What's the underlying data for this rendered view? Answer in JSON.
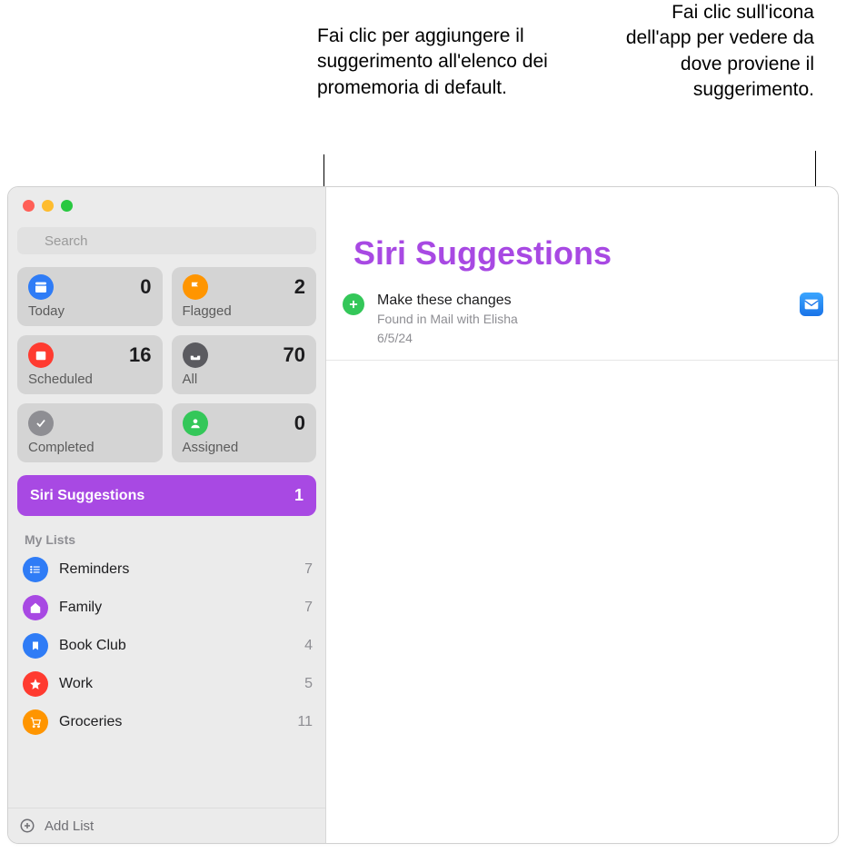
{
  "callouts": {
    "left": "Fai clic per aggiungere il suggerimento all'elenco dei promemoria di default.",
    "right": "Fai clic sull'icona dell'app per vedere da dove proviene il suggerimento."
  },
  "sidebar": {
    "search_placeholder": "Search",
    "smart": {
      "today": {
        "label": "Today",
        "count": "0",
        "color": "#2f7cf6"
      },
      "flagged": {
        "label": "Flagged",
        "count": "2",
        "color": "#ff9500"
      },
      "scheduled": {
        "label": "Scheduled",
        "count": "16",
        "color": "#ff3b30"
      },
      "all": {
        "label": "All",
        "count": "70",
        "color": "#3c3c43"
      },
      "completed": {
        "label": "Completed",
        "count": "",
        "color": "#8e8e93"
      },
      "assigned": {
        "label": "Assigned",
        "count": "0",
        "color": "#34c759"
      }
    },
    "siri": {
      "label": "Siri Suggestions",
      "count": "1"
    },
    "section": "My Lists",
    "lists": [
      {
        "name": "Reminders",
        "count": "7",
        "color": "#2f7cf6",
        "icon": "list"
      },
      {
        "name": "Family",
        "count": "7",
        "color": "#a849e3",
        "icon": "home"
      },
      {
        "name": "Book Club",
        "count": "4",
        "color": "#2f7cf6",
        "icon": "bookmark"
      },
      {
        "name": "Work",
        "count": "5",
        "color": "#ff3b30",
        "icon": "star"
      },
      {
        "name": "Groceries",
        "count": "11",
        "color": "#ff9500",
        "icon": "cart"
      }
    ],
    "add_list": "Add List"
  },
  "main": {
    "title": "Siri Suggestions",
    "suggestion": {
      "title": "Make these changes",
      "found_in": "Found in Mail with Elisha",
      "date": "6/5/24",
      "app_icon": "mail-app-icon"
    }
  }
}
